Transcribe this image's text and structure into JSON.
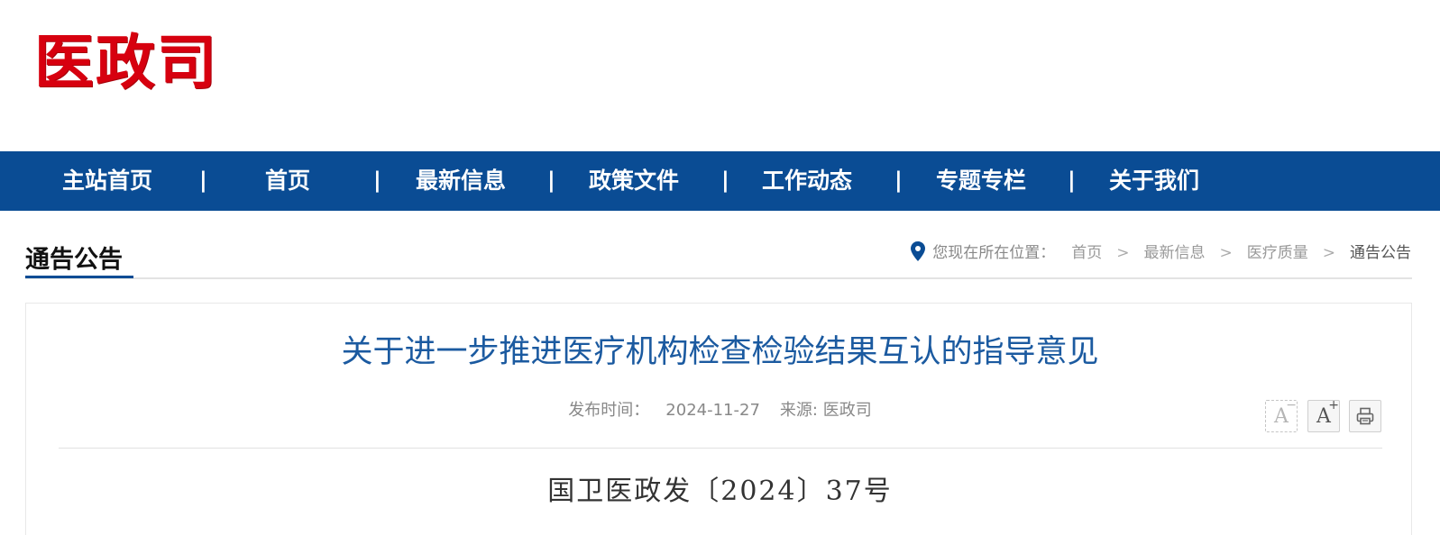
{
  "site": {
    "logo_text": "医政司"
  },
  "nav": {
    "items": [
      {
        "label": "主站首页"
      },
      {
        "label": "首页"
      },
      {
        "label": "最新信息"
      },
      {
        "label": "政策文件"
      },
      {
        "label": "工作动态"
      },
      {
        "label": "专题专栏"
      },
      {
        "label": "关于我们"
      }
    ],
    "separator": "|",
    "bg_color": "#0a4c94"
  },
  "section": {
    "title": "通告公告"
  },
  "breadcrumb": {
    "lead": "您现在所在位置：",
    "items": [
      "首页",
      "最新信息",
      "医疗质量",
      "通告公告"
    ],
    "arrow": ">"
  },
  "article": {
    "title": "关于进一步推进医疗机构检查检验结果互认的指导意见",
    "publish_label": "发布时间：",
    "publish_date": "2024-11-27",
    "source_label": "来源: ",
    "source": "医政司",
    "doc_number": "国卫医政发〔2024〕37号",
    "title_color": "#1b5aa0"
  },
  "tools": {
    "font_decrease": {
      "glyph": "A",
      "mark": "−"
    },
    "font_increase": {
      "glyph": "A",
      "mark": "+"
    },
    "print_icon": "printer-icon"
  }
}
